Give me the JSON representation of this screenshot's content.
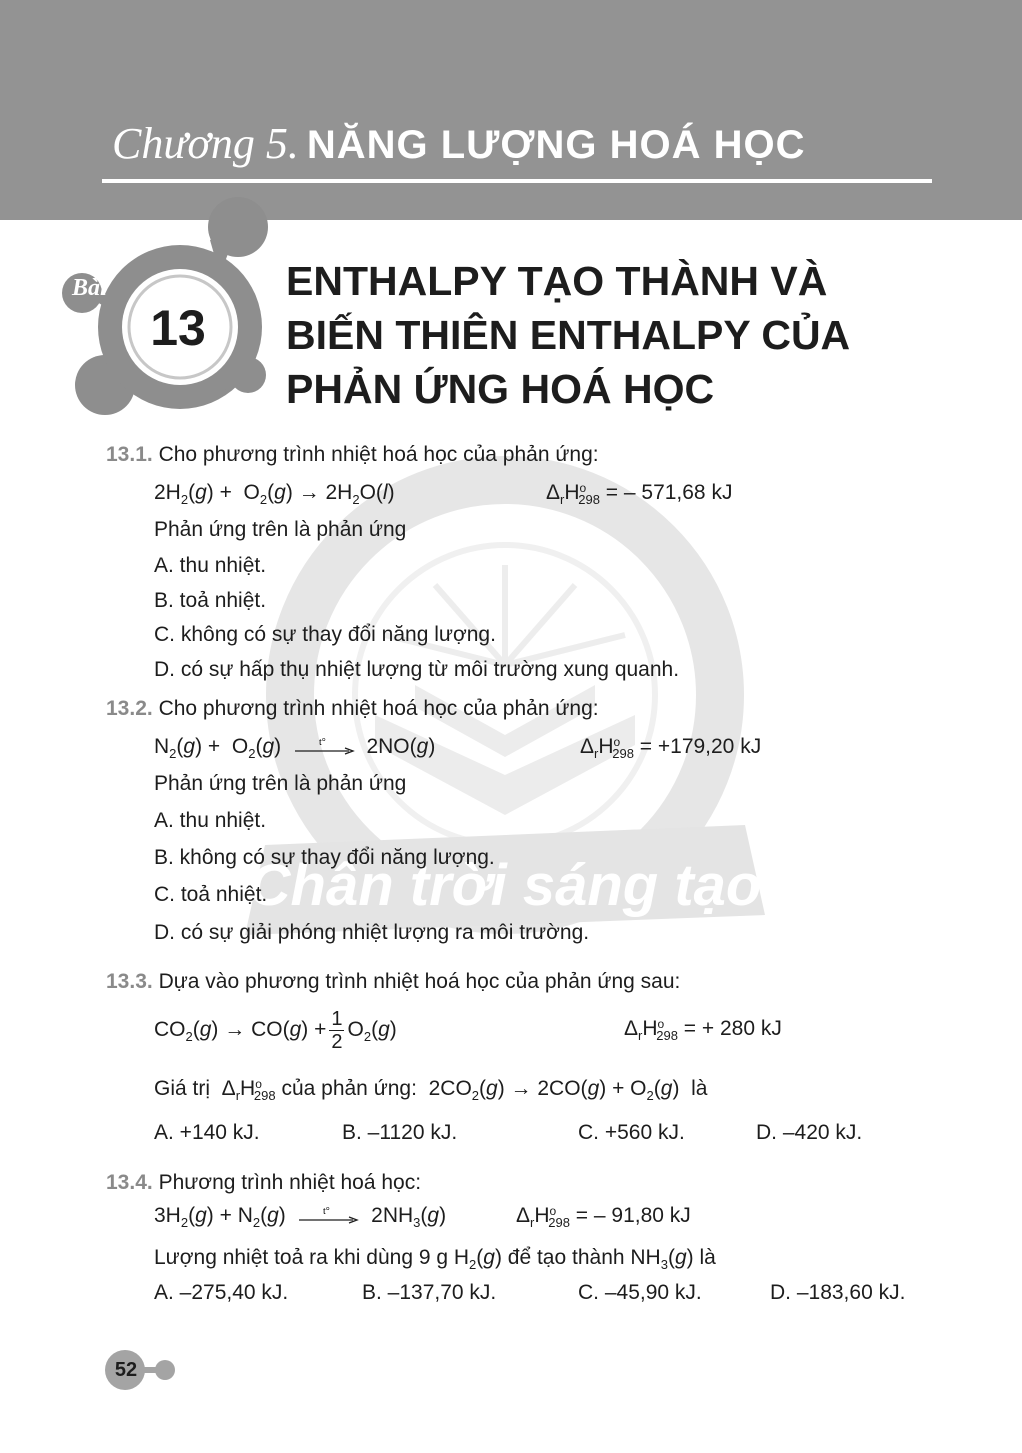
{
  "header": {
    "chapter_prefix": "Chương 5.",
    "chapter_name": "NĂNG LƯỢNG HOÁ HỌC"
  },
  "lesson": {
    "label": "Bài",
    "number": "13",
    "title_lines": [
      "ENTHALPY TẠO THÀNH VÀ",
      "BIẾN THIÊN ENTHALPY CỦA",
      "PHẢN ỨNG HOÁ HỌC"
    ]
  },
  "watermark": {
    "text": "Chân trời sáng tạo"
  },
  "questions": [
    {
      "number": "13.1.",
      "prompt": "Cho phương trình nhiệt hoá học của phản ứng:",
      "equation": "2H2(g) + O2(g) → 2H2O(l)",
      "enthalpy": "ΔrH°298 = – 571,68 kJ",
      "stem": "Phản ứng trên là phản ứng",
      "options": [
        "A. thu nhiệt.",
        "B. toả nhiệt.",
        "C. không có sự thay đổi năng lượng.",
        "D. có sự hấp thụ nhiệt lượng từ môi trường xung quanh."
      ]
    },
    {
      "number": "13.2.",
      "prompt": "Cho phương trình nhiệt hoá học của phản ứng:",
      "equation": "N2(g) + O2(g) →t° 2NO(g)",
      "enthalpy": "ΔrH°298 = +179,20 kJ",
      "stem": "Phản ứng trên là phản ứng",
      "options": [
        "A. thu nhiệt.",
        "B. không có sự thay đổi năng lượng.",
        "C. toả nhiệt.",
        "D. có sự giải phóng nhiệt lượng ra môi trường."
      ]
    },
    {
      "number": "13.3.",
      "prompt": "Dựa vào phương trình nhiệt hoá học của phản ứng sau:",
      "equation": "CO2(g) → CO(g) + 1/2 O2(g)",
      "enthalpy": "ΔrH°298 = + 280 kJ",
      "stem": "Giá trị ΔrH°298 của phản ứng: 2CO2(g) → 2CO(g) + O2(g) là",
      "options": [
        "A. +140 kJ.",
        "B. –1120 kJ.",
        "C. +560 kJ.",
        "D. –420 kJ."
      ]
    },
    {
      "number": "13.4.",
      "prompt": "Phương trình nhiệt hoá học:",
      "equation": "3H2(g) + N2(g) →t° 2NH3(g)",
      "enthalpy": "ΔrH°298 = – 91,80 kJ",
      "stem": "Lượng nhiệt toả ra khi dùng 9 g H2(g) để tạo thành NH3(g) là",
      "options": [
        "A. –275,40 kJ.",
        "B. –137,70 kJ.",
        "C. –45,90 kJ.",
        "D. –183,60 kJ."
      ]
    }
  ],
  "page": {
    "number": "52"
  },
  "colors": {
    "header_band": "#939393",
    "question_number": "#8a8a8a",
    "watermark": "#e0e0e0",
    "text": "#1d1d1d"
  }
}
